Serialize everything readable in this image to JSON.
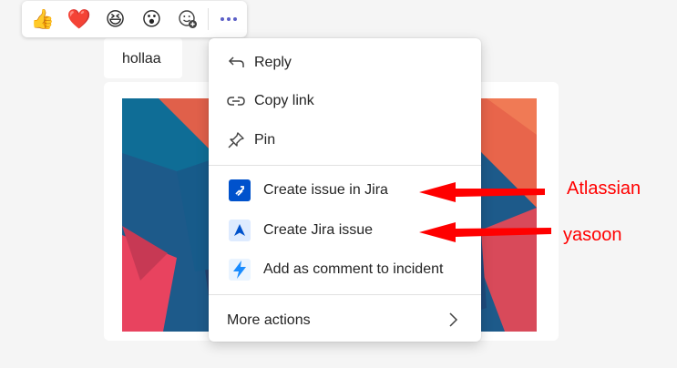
{
  "reactions": {
    "like": "👍",
    "heart": "❤️",
    "laugh": "😆",
    "surprised": "😮"
  },
  "message": {
    "text": "hollaa"
  },
  "menu": {
    "reply": "Reply",
    "copy_link": "Copy link",
    "pin": "Pin",
    "create_issue_jira": "Create issue in Jira",
    "create_jira_issue": "Create Jira issue",
    "add_comment_incident": "Add as comment to incident",
    "more_actions": "More actions"
  },
  "annotations": {
    "atlassian": "Atlassian",
    "yasoon": "yasoon"
  },
  "colors": {
    "accent": "#5b5fc7",
    "annotation": "#ff0000",
    "jira_blue": "#0052cc",
    "incident_blue": "#1a8cff"
  }
}
